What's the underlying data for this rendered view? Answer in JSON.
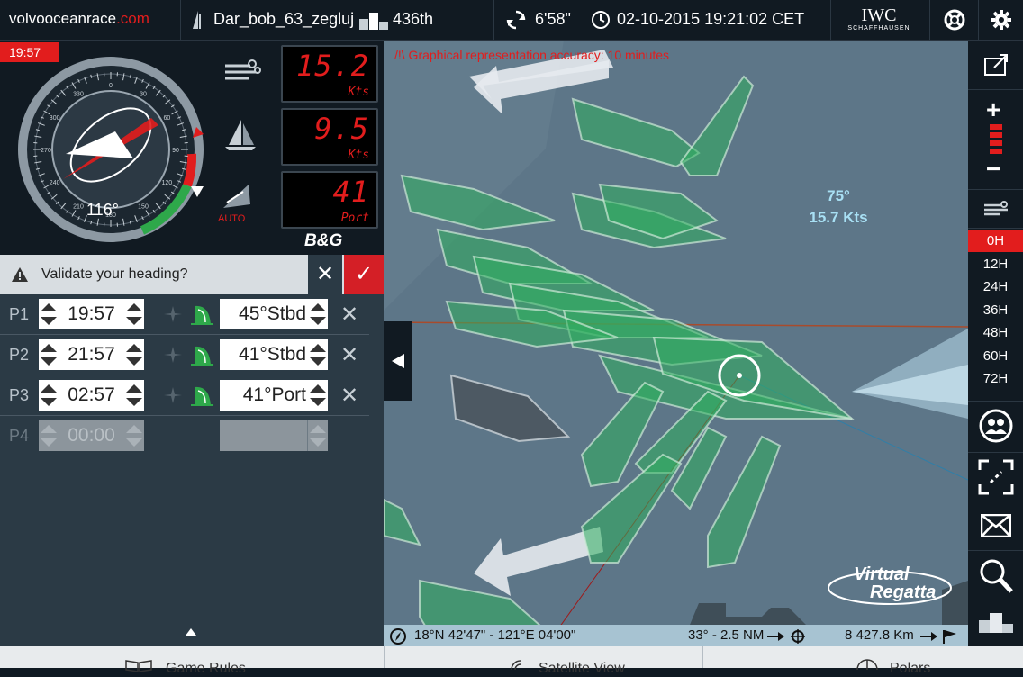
{
  "topbar": {
    "brand_main": "volvooceanrace",
    "brand_suffix": ".com",
    "boat_name": "Dar_bob_63_zegluj",
    "rank": "436th",
    "refresh_countdown": "6'58\"",
    "datetime": "02-10-2015 19:21:02 CET",
    "sponsor_main": "IWC",
    "sponsor_sub": "SCHAFFHAUSEN"
  },
  "instruments": {
    "clock_badge": "19:57",
    "heading": "116°",
    "compass_ticks": [
      "0",
      "30",
      "60",
      "90",
      "120",
      "150",
      "180",
      "210",
      "240",
      "270",
      "300",
      "330"
    ],
    "wind_speed": {
      "value": "15.2",
      "unit": "Kts"
    },
    "boat_speed": {
      "value": "9.5",
      "unit": "Kts"
    },
    "twa": {
      "value": "41",
      "unit": "Port"
    },
    "auto_label": "AUTO",
    "brand": "B&G"
  },
  "validate": {
    "text": "Validate your heading?"
  },
  "programs": [
    {
      "label": "P1",
      "time": "19:57",
      "heading": "45",
      "side": "Stbd",
      "enabled": true
    },
    {
      "label": "P2",
      "time": "21:57",
      "heading": "41",
      "side": "Stbd",
      "enabled": true
    },
    {
      "label": "P3",
      "time": "02:57",
      "heading": "41",
      "side": "Port",
      "enabled": true
    },
    {
      "label": "P4",
      "time": "00:00",
      "heading": "",
      "side": "",
      "enabled": false
    }
  ],
  "map": {
    "warning": "/!\\ Graphical representation accuracy: 10 minutes",
    "wind_direction": "75°",
    "wind_speed": "15.7 Kts",
    "position": "18°N 42'47\" - 121°E 04'00\"",
    "bearing": "33° - 2.5 NM",
    "distance": "8 427.8 Km",
    "logo_line1": "Virtual",
    "logo_line2": "Regatta"
  },
  "forecast_hours": [
    "0H",
    "12H",
    "24H",
    "36H",
    "48H",
    "60H",
    "72H"
  ],
  "bottom_tabs": [
    "Game Rules",
    "Satellite View",
    "Polars"
  ],
  "colors": {
    "accent_red": "#e21d1d",
    "boat_green": "#2fae5e",
    "map_sea": "#5d7688",
    "wind_light": "#b9dcec"
  }
}
